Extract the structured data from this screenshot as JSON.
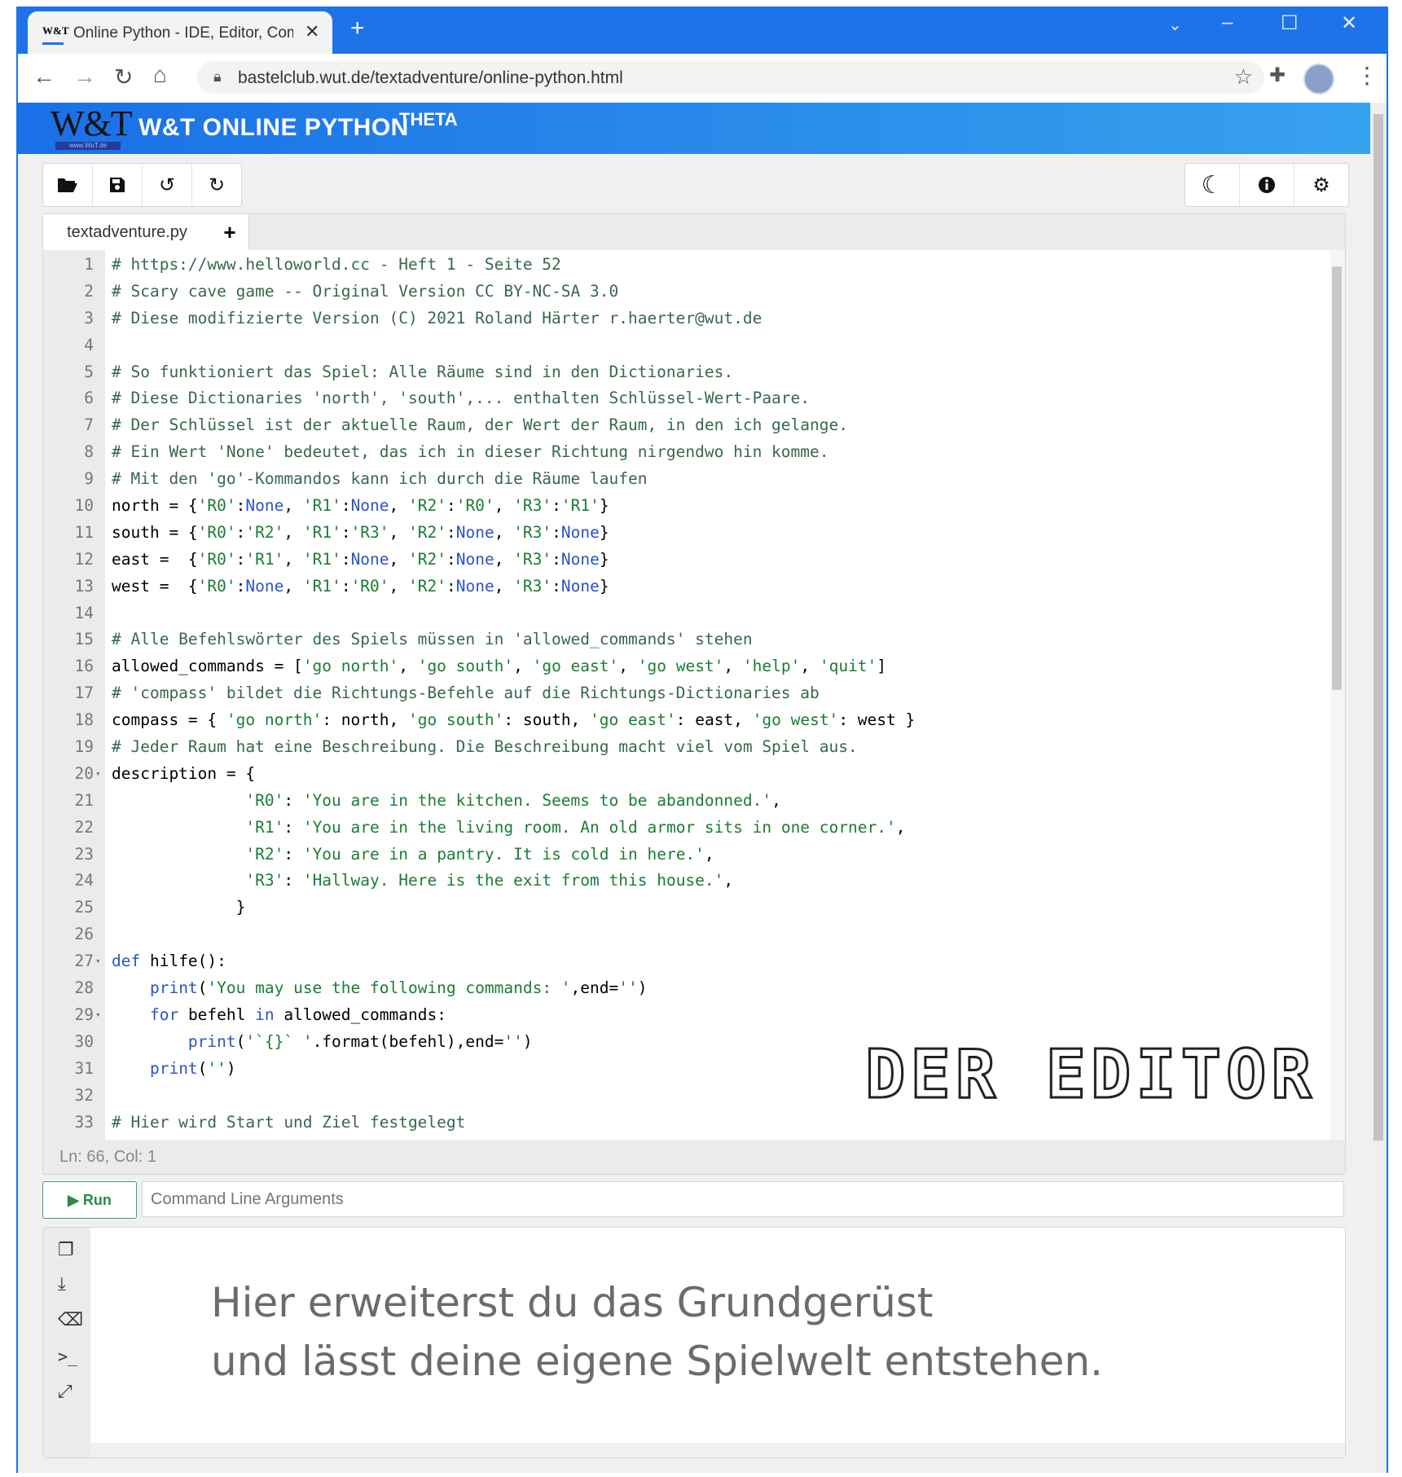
{
  "browser": {
    "tab_title": "Online Python - IDE, Editor, Com",
    "new_tab_glyph": "+",
    "close_glyph": "✕",
    "url": "bastelclub.wut.de/textadventure/online-python.html",
    "favicon_text": "W&T"
  },
  "app": {
    "logo_text": "W&T",
    "logo_subtext": "www.WuT.de",
    "title": "W&T ONLINE PYTHON",
    "version": "THETA"
  },
  "toolbar": {
    "left": [
      "folder-open",
      "save",
      "undo",
      "redo"
    ],
    "right": [
      "dark-mode",
      "info",
      "settings"
    ]
  },
  "editor": {
    "filename": "textadventure.py",
    "add_file_glyph": "+",
    "status": "Ln: 66,  Col: 1",
    "lines": [
      {
        "n": "1",
        "segs": [
          [
            "c",
            "# https://www.helloworld.cc - Heft 1 - Seite 52"
          ]
        ]
      },
      {
        "n": "2",
        "segs": [
          [
            "c",
            "# Scary cave game -- Original Version CC BY-NC-SA 3.0"
          ]
        ]
      },
      {
        "n": "3",
        "segs": [
          [
            "c",
            "# Diese modifizierte Version (C) 2021 Roland Härter r.haerter@wut.de"
          ]
        ]
      },
      {
        "n": "4",
        "segs": []
      },
      {
        "n": "5",
        "segs": [
          [
            "c",
            "# So funktioniert das Spiel: Alle Räume sind in den Dictionaries."
          ]
        ]
      },
      {
        "n": "6",
        "segs": [
          [
            "c",
            "# Diese Dictionaries 'north', 'south',... enthalten Schlüssel-Wert-Paare."
          ]
        ]
      },
      {
        "n": "7",
        "segs": [
          [
            "c",
            "# Der Schlüssel ist der aktuelle Raum, der Wert der Raum, in den ich gelange."
          ]
        ]
      },
      {
        "n": "8",
        "segs": [
          [
            "c",
            "# Ein Wert 'None' bedeutet, das ich in dieser Richtung nirgendwo hin komme."
          ]
        ]
      },
      {
        "n": "9",
        "segs": [
          [
            "c",
            "# Mit den 'go'-Kommandos kann ich durch die Räume laufen"
          ]
        ]
      },
      {
        "n": "10",
        "segs": [
          [
            "p",
            "north = {"
          ],
          [
            "s",
            "'R0'"
          ],
          [
            "p",
            ":"
          ],
          [
            "k",
            "None"
          ],
          [
            "p",
            ", "
          ],
          [
            "s",
            "'R1'"
          ],
          [
            "p",
            ":"
          ],
          [
            "k",
            "None"
          ],
          [
            "p",
            ", "
          ],
          [
            "s",
            "'R2'"
          ],
          [
            "p",
            ":"
          ],
          [
            "s",
            "'R0'"
          ],
          [
            "p",
            ", "
          ],
          [
            "s",
            "'R3'"
          ],
          [
            "p",
            ":"
          ],
          [
            "s",
            "'R1'"
          ],
          [
            "p",
            "}"
          ]
        ]
      },
      {
        "n": "11",
        "segs": [
          [
            "p",
            "south = {"
          ],
          [
            "s",
            "'R0'"
          ],
          [
            "p",
            ":"
          ],
          [
            "s",
            "'R2'"
          ],
          [
            "p",
            ", "
          ],
          [
            "s",
            "'R1'"
          ],
          [
            "p",
            ":"
          ],
          [
            "s",
            "'R3'"
          ],
          [
            "p",
            ", "
          ],
          [
            "s",
            "'R2'"
          ],
          [
            "p",
            ":"
          ],
          [
            "k",
            "None"
          ],
          [
            "p",
            ", "
          ],
          [
            "s",
            "'R3'"
          ],
          [
            "p",
            ":"
          ],
          [
            "k",
            "None"
          ],
          [
            "p",
            "}"
          ]
        ]
      },
      {
        "n": "12",
        "segs": [
          [
            "p",
            "east =  {"
          ],
          [
            "s",
            "'R0'"
          ],
          [
            "p",
            ":"
          ],
          [
            "s",
            "'R1'"
          ],
          [
            "p",
            ", "
          ],
          [
            "s",
            "'R1'"
          ],
          [
            "p",
            ":"
          ],
          [
            "k",
            "None"
          ],
          [
            "p",
            ", "
          ],
          [
            "s",
            "'R2'"
          ],
          [
            "p",
            ":"
          ],
          [
            "k",
            "None"
          ],
          [
            "p",
            ", "
          ],
          [
            "s",
            "'R3'"
          ],
          [
            "p",
            ":"
          ],
          [
            "k",
            "None"
          ],
          [
            "p",
            "}"
          ]
        ]
      },
      {
        "n": "13",
        "segs": [
          [
            "p",
            "west =  {"
          ],
          [
            "s",
            "'R0'"
          ],
          [
            "p",
            ":"
          ],
          [
            "k",
            "None"
          ],
          [
            "p",
            ", "
          ],
          [
            "s",
            "'R1'"
          ],
          [
            "p",
            ":"
          ],
          [
            "s",
            "'R0'"
          ],
          [
            "p",
            ", "
          ],
          [
            "s",
            "'R2'"
          ],
          [
            "p",
            ":"
          ],
          [
            "k",
            "None"
          ],
          [
            "p",
            ", "
          ],
          [
            "s",
            "'R3'"
          ],
          [
            "p",
            ":"
          ],
          [
            "k",
            "None"
          ],
          [
            "p",
            "}"
          ]
        ]
      },
      {
        "n": "14",
        "segs": []
      },
      {
        "n": "15",
        "segs": [
          [
            "c",
            "# Alle Befehlswörter des Spiels müssen in 'allowed_commands' stehen"
          ]
        ]
      },
      {
        "n": "16",
        "segs": [
          [
            "p",
            "allowed_commands = ["
          ],
          [
            "s",
            "'go north'"
          ],
          [
            "p",
            ", "
          ],
          [
            "s",
            "'go south'"
          ],
          [
            "p",
            ", "
          ],
          [
            "s",
            "'go east'"
          ],
          [
            "p",
            ", "
          ],
          [
            "s",
            "'go west'"
          ],
          [
            "p",
            ", "
          ],
          [
            "s",
            "'help'"
          ],
          [
            "p",
            ", "
          ],
          [
            "s",
            "'quit'"
          ],
          [
            "p",
            "]"
          ]
        ]
      },
      {
        "n": "17",
        "segs": [
          [
            "c",
            "# 'compass' bildet die Richtungs-Befehle auf die Richtungs-Dictionaries ab"
          ]
        ]
      },
      {
        "n": "18",
        "segs": [
          [
            "p",
            "compass = { "
          ],
          [
            "s",
            "'go north'"
          ],
          [
            "p",
            ": north, "
          ],
          [
            "s",
            "'go south'"
          ],
          [
            "p",
            ": south, "
          ],
          [
            "s",
            "'go east'"
          ],
          [
            "p",
            ": east, "
          ],
          [
            "s",
            "'go west'"
          ],
          [
            "p",
            ": west }"
          ]
        ]
      },
      {
        "n": "19",
        "segs": [
          [
            "c",
            "# Jeder Raum hat eine Beschreibung. Die Beschreibung macht viel vom Spiel aus."
          ]
        ]
      },
      {
        "n": "20",
        "fold": true,
        "segs": [
          [
            "p",
            "description = {"
          ]
        ]
      },
      {
        "n": "21",
        "segs": [
          [
            "p",
            "              "
          ],
          [
            "s",
            "'R0'"
          ],
          [
            "p",
            ": "
          ],
          [
            "s",
            "'You are in the kitchen. Seems to be abandonned.'"
          ],
          [
            "p",
            ","
          ]
        ]
      },
      {
        "n": "22",
        "segs": [
          [
            "p",
            "              "
          ],
          [
            "s",
            "'R1'"
          ],
          [
            "p",
            ": "
          ],
          [
            "s",
            "'You are in the living room. An old armor sits in one corner.'"
          ],
          [
            "p",
            ","
          ]
        ]
      },
      {
        "n": "23",
        "segs": [
          [
            "p",
            "              "
          ],
          [
            "s",
            "'R2'"
          ],
          [
            "p",
            ": "
          ],
          [
            "s",
            "'You are in a pantry. It is cold in here.'"
          ],
          [
            "p",
            ","
          ]
        ]
      },
      {
        "n": "24",
        "segs": [
          [
            "p",
            "              "
          ],
          [
            "s",
            "'R3'"
          ],
          [
            "p",
            ": "
          ],
          [
            "s",
            "'Hallway. Here is the exit from this house.'"
          ],
          [
            "p",
            ","
          ]
        ]
      },
      {
        "n": "25",
        "segs": [
          [
            "p",
            "             }"
          ]
        ]
      },
      {
        "n": "26",
        "segs": []
      },
      {
        "n": "27",
        "fold": true,
        "segs": [
          [
            "k",
            "def"
          ],
          [
            "p",
            " hilfe():"
          ]
        ]
      },
      {
        "n": "28",
        "segs": [
          [
            "p",
            "    "
          ],
          [
            "k",
            "print"
          ],
          [
            "p",
            "("
          ],
          [
            "s",
            "'You may use the following commands: '"
          ],
          [
            "p",
            ",end="
          ],
          [
            "s",
            "''"
          ],
          [
            "p",
            ")"
          ]
        ]
      },
      {
        "n": "29",
        "fold": true,
        "segs": [
          [
            "p",
            "    "
          ],
          [
            "k",
            "for"
          ],
          [
            "p",
            " befehl "
          ],
          [
            "k",
            "in"
          ],
          [
            "p",
            " allowed_commands:"
          ]
        ]
      },
      {
        "n": "30",
        "segs": [
          [
            "p",
            "        "
          ],
          [
            "k",
            "print"
          ],
          [
            "p",
            "("
          ],
          [
            "s",
            "'`{}` '"
          ],
          [
            "p",
            ".format(befehl),end="
          ],
          [
            "s",
            "''"
          ],
          [
            "p",
            ")"
          ]
        ]
      },
      {
        "n": "31",
        "segs": [
          [
            "p",
            "    "
          ],
          [
            "k",
            "print"
          ],
          [
            "p",
            "("
          ],
          [
            "s",
            "''"
          ],
          [
            "p",
            ")"
          ]
        ]
      },
      {
        "n": "32",
        "segs": []
      },
      {
        "n": "33",
        "segs": [
          [
            "c",
            "# Hier wird Start und Ziel festgelegt"
          ]
        ]
      }
    ]
  },
  "overlay": {
    "banner": "DER EDITOR"
  },
  "runbar": {
    "run_label": "Run",
    "args_placeholder": "Command Line Arguments"
  },
  "console": {
    "line1": "Hier erweiterst du das Grundgerüst",
    "line2": "und lässt deine eigene Spielwelt entstehen."
  },
  "colors": {
    "chrome_blue": "#1e73e8",
    "comment": "#37694a",
    "string": "#1b7d34",
    "keyword": "#2a53c7",
    "run_green": "#2a8b44"
  }
}
